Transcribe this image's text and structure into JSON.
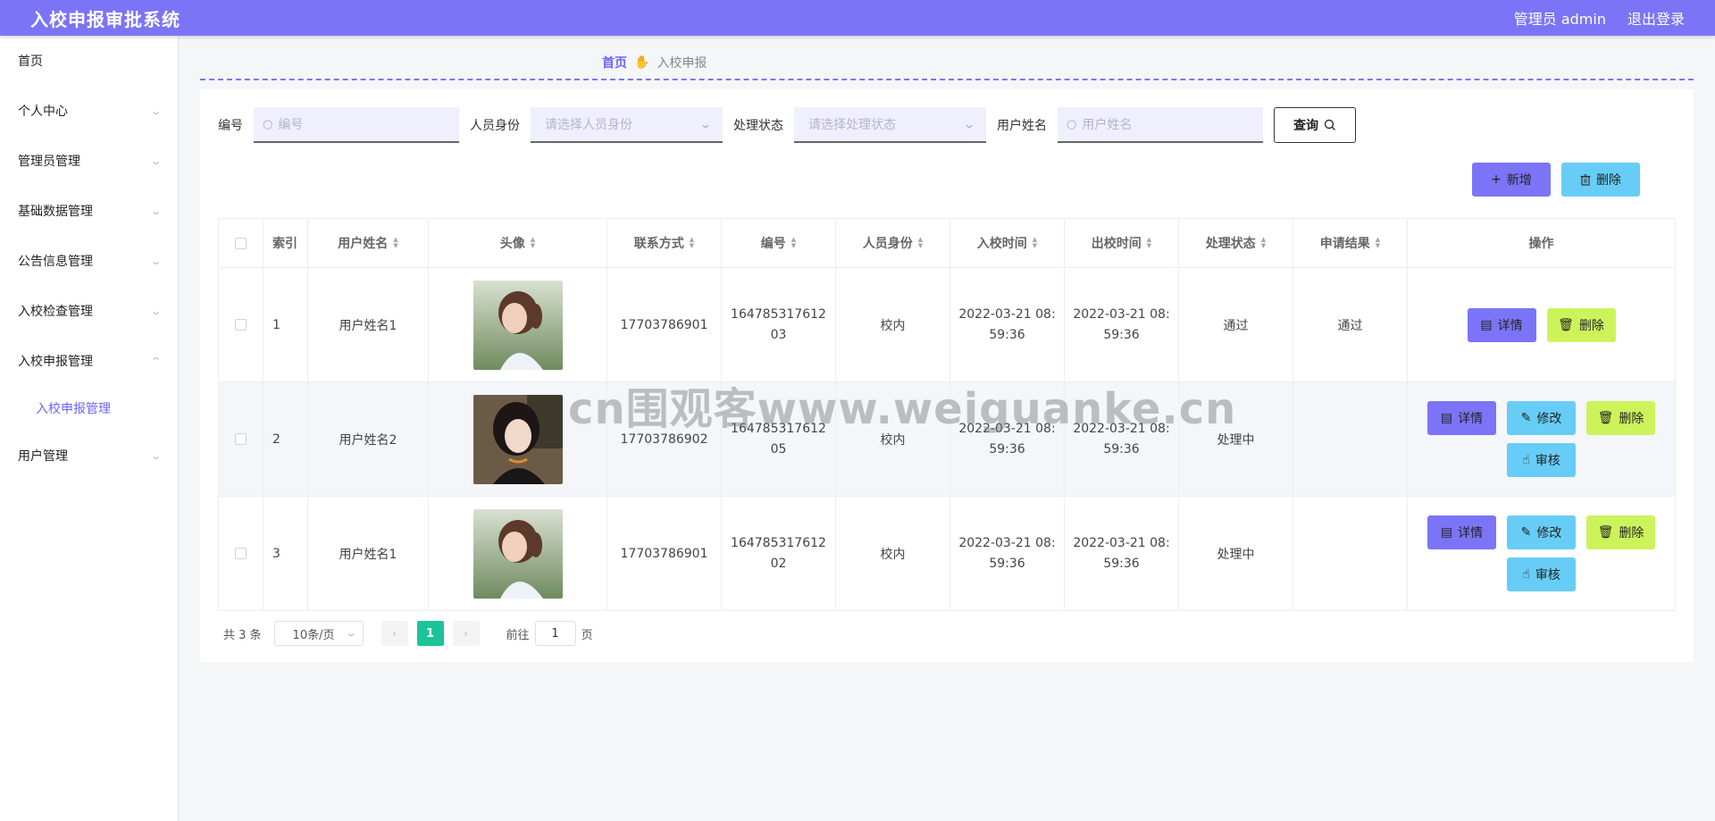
{
  "header": {
    "title": "入校申报审批系统",
    "user_label": "管理员 admin",
    "logout_label": "退出登录"
  },
  "sidebar": {
    "items": [
      {
        "label": "首页",
        "has_children": false
      },
      {
        "label": "个人中心",
        "has_children": true,
        "expanded": false
      },
      {
        "label": "管理员管理",
        "has_children": true,
        "expanded": false
      },
      {
        "label": "基础数据管理",
        "has_children": true,
        "expanded": false
      },
      {
        "label": "公告信息管理",
        "has_children": true,
        "expanded": false
      },
      {
        "label": "入校检查管理",
        "has_children": true,
        "expanded": false
      },
      {
        "label": "入校申报管理",
        "has_children": true,
        "expanded": true,
        "children": [
          {
            "label": "入校申报管理",
            "active": true
          }
        ]
      },
      {
        "label": "用户管理",
        "has_children": true,
        "expanded": false
      }
    ]
  },
  "breadcrumb": {
    "home": "首页",
    "current": "入校申报"
  },
  "search": {
    "code_label": "编号",
    "code_placeholder": "编号",
    "identity_label": "人员身份",
    "identity_placeholder": "请选择人员身份",
    "status_label": "处理状态",
    "status_placeholder": "请选择处理状态",
    "name_label": "用户姓名",
    "name_placeholder": "用户姓名",
    "query_label": "查询"
  },
  "actions": {
    "add_label": "新增",
    "delete_label": "删除"
  },
  "table": {
    "headers": [
      "索引",
      "用户姓名",
      "头像",
      "联系方式",
      "编号",
      "人员身份",
      "入校时间",
      "出校时间",
      "处理状态",
      "申请结果",
      "操作"
    ],
    "rows": [
      {
        "index": "1",
        "name": "用户姓名1",
        "phone": "17703786901",
        "code": "16478531761203",
        "identity": "校内",
        "in_time": "2022-03-21 08:59:36",
        "out_time": "2022-03-21 08:59:36",
        "status": "通过",
        "result": "通过",
        "ops": [
          "详情",
          "删除"
        ]
      },
      {
        "index": "2",
        "name": "用户姓名2",
        "phone": "17703786902",
        "code": "16478531761205",
        "identity": "校内",
        "in_time": "2022-03-21 08:59:36",
        "out_time": "2022-03-21 08:59:36",
        "status": "处理中",
        "result": "",
        "ops": [
          "详情",
          "修改",
          "删除",
          "审核"
        ]
      },
      {
        "index": "3",
        "name": "用户姓名1",
        "phone": "17703786901",
        "code": "16478531761202",
        "identity": "校内",
        "in_time": "2022-03-21 08:59:36",
        "out_time": "2022-03-21 08:59:36",
        "status": "处理中",
        "result": "",
        "ops": [
          "详情",
          "修改",
          "删除",
          "审核"
        ]
      }
    ]
  },
  "pagination": {
    "total_label": "共 3 条",
    "page_size": "10条/页",
    "current_page": "1",
    "goto_label": "前往",
    "goto_value": "1",
    "page_suffix": "页"
  },
  "watermark": "cn围观客www.weiguanke.cn",
  "colors": {
    "primary": "#7b74f7",
    "info": "#67cdf6",
    "lime": "#cdf35b",
    "page_active": "#1cc39a"
  }
}
